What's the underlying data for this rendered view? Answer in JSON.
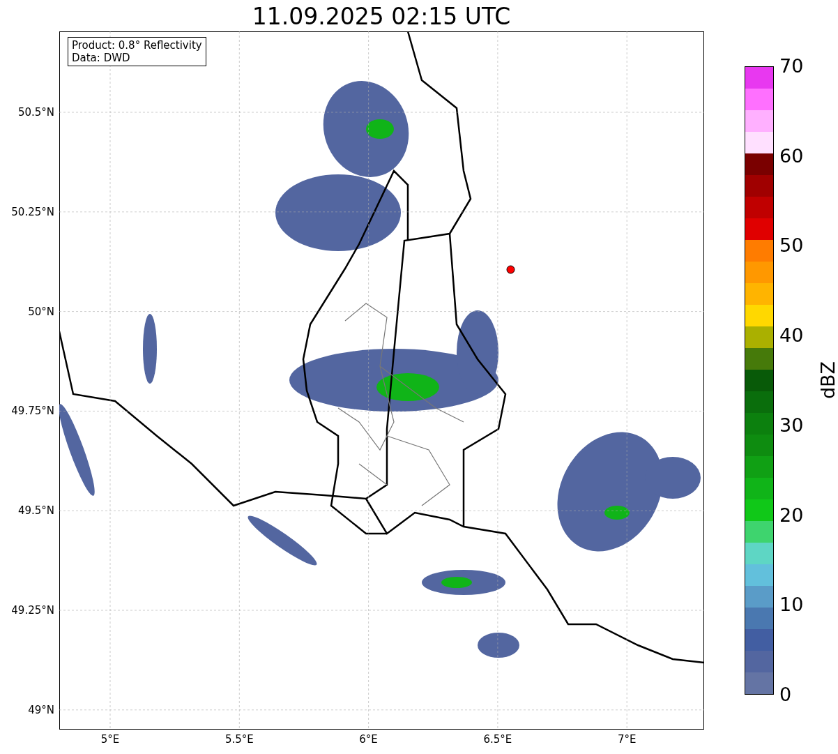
{
  "title": "11.09.2025 02:15 UTC",
  "info_box": [
    "Product: 0.8° Reflectivity",
    "Data: DWD"
  ],
  "map": {
    "y_ticks": [
      "50.5°N",
      "50.25°N",
      "50°N",
      "49.75°N",
      "49.5°N",
      "49.25°N",
      "49°N"
    ],
    "x_ticks": [
      "5°E",
      "5.5°E",
      "6°E",
      "6.5°E",
      "7°E"
    ]
  },
  "colorbar": {
    "label": "dBZ",
    "ticks": [
      "70",
      "60",
      "50",
      "40",
      "30",
      "20",
      "10",
      "0"
    ],
    "segments": [
      {
        "color": "#6474a4"
      },
      {
        "color": "#5366a0"
      },
      {
        "color": "#425ea2"
      },
      {
        "color": "#4a78b0"
      },
      {
        "color": "#5a9cc8"
      },
      {
        "color": "#62c0dc"
      },
      {
        "color": "#5ed6c4"
      },
      {
        "color": "#3ed46e"
      },
      {
        "color": "#10c818"
      },
      {
        "color": "#10b418"
      },
      {
        "color": "#10a014"
      },
      {
        "color": "#0e8c10"
      },
      {
        "color": "#0c800e"
      },
      {
        "color": "#0a6e0c"
      },
      {
        "color": "#085a08"
      },
      {
        "color": "#467a0a"
      },
      {
        "color": "#aab000"
      },
      {
        "color": "#ffd800"
      },
      {
        "color": "#ffb400"
      },
      {
        "color": "#ff9800"
      },
      {
        "color": "#ff7c00"
      },
      {
        "color": "#e00000"
      },
      {
        "color": "#c00000"
      },
      {
        "color": "#a00000"
      },
      {
        "color": "#7a0000"
      },
      {
        "color": "#ffe0ff"
      },
      {
        "color": "#ffb0ff"
      },
      {
        "color": "#ff70ff"
      },
      {
        "color": "#e838f0"
      }
    ]
  }
}
